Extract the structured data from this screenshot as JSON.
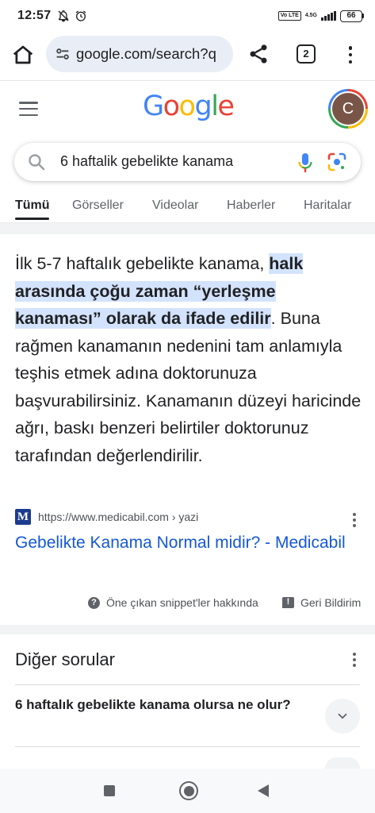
{
  "status_bar": {
    "time": "12:57",
    "network_label": "4.5G",
    "volte_label": "Vo LTE",
    "battery": "66"
  },
  "browser": {
    "url": "google.com/search?q",
    "tab_count": "2"
  },
  "google": {
    "logo_text": [
      "G",
      "o",
      "o",
      "g",
      "l",
      "e"
    ],
    "logo_colors": [
      "#4285f4",
      "#ea4335",
      "#fbbc05",
      "#4285f4",
      "#34a853",
      "#ea4335"
    ],
    "avatar_letter": "C",
    "avatar_color": "#795548"
  },
  "search": {
    "query": "6 haftalik gebelikte kanama"
  },
  "tabs": [
    {
      "label": "Tümü",
      "active": true
    },
    {
      "label": "Görseller",
      "active": false
    },
    {
      "label": "Videolar",
      "active": false
    },
    {
      "label": "Haberler",
      "active": false
    },
    {
      "label": "Haritalar",
      "active": false
    }
  ],
  "featured_snippet": {
    "text_before": "İlk 5-7 haftalık gebelikte kanama, ",
    "highlight": "halk arasında çoğu zaman “yerleşme kanaması” olarak da ifade edilir",
    "text_after": ". Buna rağmen kanamanın nedenini tam anlamıyla teşhis etmek adına doktorunuza başvurabilirsiniz. Kanamanın düzeyi haricinde ağrı, baskı benzeri belirtiler doktorunuz tarafından değerlendirilir.",
    "favicon_letter": "M",
    "source_url": "https://www.medicabil.com › yazi",
    "result_title": "Gebelikte Kanama Normal midir? - Medicabil",
    "about_label": "Öne çıkan snippet'ler hakkında",
    "feedback_label": "Geri Bildirim",
    "highlight_color": "#d3e3fd",
    "link_color": "#1558d6"
  },
  "other_questions": {
    "title": "Diğer sorular",
    "items": [
      "6 haftalık gebelikte kanama olursa ne olur?"
    ]
  }
}
